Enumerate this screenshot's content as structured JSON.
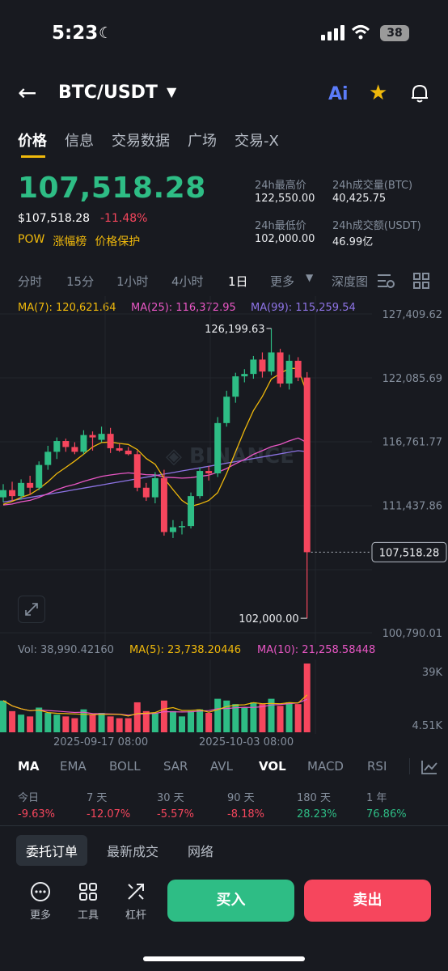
{
  "status_bar": {
    "time": "5:23",
    "battery": "38"
  },
  "header": {
    "pair": "BTC/USDT",
    "ai_label": "Ai"
  },
  "tabs": [
    "价格",
    "信息",
    "交易数据",
    "广场",
    "交易-X"
  ],
  "ticker": {
    "price": "107,518.28",
    "fiat_price": "$107,518.28",
    "change_pct": "-11.48%",
    "tags": [
      "POW",
      "涨幅榜",
      "价格保护"
    ],
    "high_label": "24h最高价",
    "high": "122,550.00",
    "low_label": "24h最低价",
    "low": "102,000.00",
    "vol_btc_label": "24h成交量(BTC)",
    "vol_btc": "40,425.75",
    "vol_usdt_label": "24h成交额(USDT)",
    "vol_usdt": "46.99亿"
  },
  "timeframes": [
    "分时",
    "15分",
    "1小时",
    "4小时",
    "1日",
    "更多",
    "深度图"
  ],
  "active_timeframe": "1日",
  "chart_data": {
    "type": "candlestick",
    "ma_labels": {
      "ma7": "MA(7): 120,621.64",
      "ma25": "MA(25): 116,372.95",
      "ma99": "MA(99): 115,259.54"
    },
    "y_ticks": [
      "127,409.62",
      "122,085.69",
      "116,761.77",
      "111,437.86",
      "100,790.01"
    ],
    "ylim": [
      100790.01,
      127409.62
    ],
    "current_price_label": "107,518.28",
    "high_marker": "126,199.63",
    "low_marker": "102,000.00",
    "watermark": "BINANCE",
    "candles": [
      {
        "o": 112100,
        "c": 112700,
        "h": 113200,
        "l": 111700
      },
      {
        "o": 112700,
        "c": 112200,
        "h": 113400,
        "l": 111800
      },
      {
        "o": 112200,
        "c": 113300,
        "h": 113600,
        "l": 111900
      },
      {
        "o": 113300,
        "c": 112900,
        "h": 113900,
        "l": 112300
      },
      {
        "o": 112900,
        "c": 114800,
        "h": 115100,
        "l": 112700
      },
      {
        "o": 114800,
        "c": 115900,
        "h": 116400,
        "l": 114400
      },
      {
        "o": 115900,
        "c": 116800,
        "h": 117100,
        "l": 115300
      },
      {
        "o": 116800,
        "c": 116300,
        "h": 117000,
        "l": 115900
      },
      {
        "o": 116300,
        "c": 115900,
        "h": 116700,
        "l": 115700
      },
      {
        "o": 115900,
        "c": 117300,
        "h": 117700,
        "l": 115700
      },
      {
        "o": 117300,
        "c": 117100,
        "h": 117600,
        "l": 116000
      },
      {
        "o": 116900,
        "c": 117400,
        "h": 118000,
        "l": 116700
      },
      {
        "o": 117400,
        "c": 116200,
        "h": 117900,
        "l": 115800
      },
      {
        "o": 116200,
        "c": 116000,
        "h": 116600,
        "l": 115900
      },
      {
        "o": 116000,
        "c": 115700,
        "h": 116300,
        "l": 115600
      },
      {
        "o": 115700,
        "c": 112900,
        "h": 116000,
        "l": 112600
      },
      {
        "o": 112900,
        "c": 112100,
        "h": 113300,
        "l": 111800
      },
      {
        "o": 112100,
        "c": 113700,
        "h": 114200,
        "l": 111600
      },
      {
        "o": 113700,
        "c": 109200,
        "h": 114400,
        "l": 108900
      },
      {
        "o": 109200,
        "c": 109600,
        "h": 110200,
        "l": 108700
      },
      {
        "o": 109600,
        "c": 109700,
        "h": 110100,
        "l": 109000
      },
      {
        "o": 109700,
        "c": 112200,
        "h": 112500,
        "l": 109500
      },
      {
        "o": 112200,
        "c": 114300,
        "h": 114600,
        "l": 112000
      },
      {
        "o": 114300,
        "c": 114100,
        "h": 114700,
        "l": 113500
      },
      {
        "o": 114100,
        "c": 118300,
        "h": 118800,
        "l": 113800
      },
      {
        "o": 118300,
        "c": 120500,
        "h": 121000,
        "l": 118000
      },
      {
        "o": 120500,
        "c": 122200,
        "h": 122500,
        "l": 120000
      },
      {
        "o": 122200,
        "c": 122400,
        "h": 122800,
        "l": 121700
      },
      {
        "o": 122400,
        "c": 123600,
        "h": 123900,
        "l": 122000
      },
      {
        "o": 123600,
        "c": 122600,
        "h": 124200,
        "l": 122100
      },
      {
        "o": 122600,
        "c": 124200,
        "h": 126199.63,
        "l": 122300
      },
      {
        "o": 124200,
        "c": 121600,
        "h": 124500,
        "l": 121300
      },
      {
        "o": 121600,
        "c": 123500,
        "h": 124000,
        "l": 121100
      },
      {
        "o": 123500,
        "c": 122100,
        "h": 123800,
        "l": 121800
      },
      {
        "o": 122100,
        "c": 107518.28,
        "h": 122550,
        "l": 102000
      }
    ]
  },
  "volume": {
    "vol_label": "Vol: 38,990.42160",
    "ma5_label": "MA(5): 23,738.20446",
    "ma10_label": "MA(10): 21,258.58448",
    "y_ticks": [
      "39K",
      "4.51K"
    ],
    "values": [
      18,
      12,
      10,
      9,
      14,
      11,
      10,
      9,
      8,
      13,
      10,
      11,
      9,
      8,
      8,
      17,
      12,
      11,
      18,
      12,
      9,
      12,
      13,
      11,
      19,
      18,
      16,
      14,
      17,
      16,
      19,
      15,
      17,
      16,
      39
    ]
  },
  "x_ticks": [
    "2025-09-17 08:00",
    "2025-10-03 08:00"
  ],
  "indicators": [
    "MA",
    "EMA",
    "BOLL",
    "SAR",
    "AVL",
    "VOL",
    "MACD",
    "RSI"
  ],
  "performance": [
    {
      "label": "今日",
      "value": "-9.63%",
      "up": false
    },
    {
      "label": "7 天",
      "value": "-12.07%",
      "up": false
    },
    {
      "label": "30 天",
      "value": "-5.57%",
      "up": false
    },
    {
      "label": "90 天",
      "value": "-8.18%",
      "up": false
    },
    {
      "label": "180 天",
      "value": "28.23%",
      "up": true
    },
    {
      "label": "1 年",
      "value": "76.86%",
      "up": true
    }
  ],
  "order_tabs": [
    "委托订单",
    "最新成交",
    "网络"
  ],
  "bottom_tools": [
    "更多",
    "工具",
    "杠杆"
  ],
  "buy_label": "买入",
  "sell_label": "卖出",
  "colors": {
    "up": "#2ebd85",
    "down": "#f6465d",
    "accent": "#f0b90b",
    "ma7": "#f0b90b",
    "ma25": "#e957c5",
    "ma99": "#8e74e6"
  }
}
